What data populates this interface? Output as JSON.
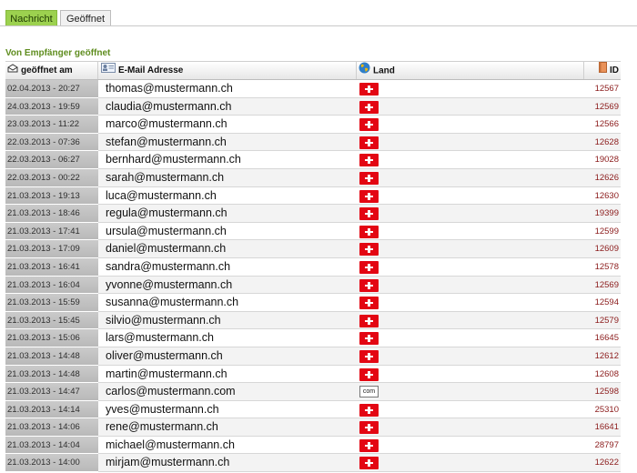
{
  "tabs": [
    {
      "label": "Nachricht",
      "active": true
    },
    {
      "label": "Geöffnet",
      "active": false
    }
  ],
  "section_title": "Von Empfänger geöffnet",
  "columns": {
    "opened_at": "geöffnet am",
    "email": "E-Mail Adresse",
    "country": "Land",
    "id": "ID"
  },
  "colors": {
    "accent_green": "#9cd14f",
    "title_green": "#5f8d1f",
    "id_red": "#8b1b1b",
    "flag_red": "#e30613"
  },
  "rows": [
    {
      "date": "02.04.2013 - 20:27",
      "email": "thomas@mustermann.ch",
      "country": "ch",
      "id": "12567"
    },
    {
      "date": "24.03.2013 - 19:59",
      "email": "claudia@mustermann.ch",
      "country": "ch",
      "id": "12569"
    },
    {
      "date": "23.03.2013 - 11:22",
      "email": "marco@mustermann.ch",
      "country": "ch",
      "id": "12566"
    },
    {
      "date": "22.03.2013 - 07:36",
      "email": "stefan@mustermann.ch",
      "country": "ch",
      "id": "12628"
    },
    {
      "date": "22.03.2013 - 06:27",
      "email": "bernhard@mustermann.ch",
      "country": "ch",
      "id": "19028"
    },
    {
      "date": "22.03.2013 - 00:22",
      "email": "sarah@mustermann.ch",
      "country": "ch",
      "id": "12626"
    },
    {
      "date": "21.03.2013 - 19:13",
      "email": "luca@mustermann.ch",
      "country": "ch",
      "id": "12630"
    },
    {
      "date": "21.03.2013 - 18:46",
      "email": "regula@mustermann.ch",
      "country": "ch",
      "id": "19399"
    },
    {
      "date": "21.03.2013 - 17:41",
      "email": "ursula@mustermann.ch",
      "country": "ch",
      "id": "12599"
    },
    {
      "date": "21.03.2013 - 17:09",
      "email": "daniel@mustermann.ch",
      "country": "ch",
      "id": "12609"
    },
    {
      "date": "21.03.2013 - 16:41",
      "email": "sandra@mustermann.ch",
      "country": "ch",
      "id": "12578"
    },
    {
      "date": "21.03.2013 - 16:04",
      "email": "yvonne@mustermann.ch",
      "country": "ch",
      "id": "12569"
    },
    {
      "date": "21.03.2013 - 15:59",
      "email": "susanna@mustermann.ch",
      "country": "ch",
      "id": "12594"
    },
    {
      "date": "21.03.2013 - 15:45",
      "email": "silvio@mustermann.ch",
      "country": "ch",
      "id": "12579"
    },
    {
      "date": "21.03.2013 - 15:06",
      "email": "lars@mustermann.ch",
      "country": "ch",
      "id": "16645"
    },
    {
      "date": "21.03.2013 - 14:48",
      "email": "oliver@mustermann.ch",
      "country": "ch",
      "id": "12612"
    },
    {
      "date": "21.03.2013 - 14:48",
      "email": "martin@mustermann.ch",
      "country": "ch",
      "id": "12608"
    },
    {
      "date": "21.03.2013 - 14:47",
      "email": "carlos@mustermann.com",
      "country": "com",
      "country_label": "com",
      "id": "12598"
    },
    {
      "date": "21.03.2013 - 14:14",
      "email": "yves@mustermann.ch",
      "country": "ch",
      "id": "25310"
    },
    {
      "date": "21.03.2013 - 14:06",
      "email": "rene@mustermann.ch",
      "country": "ch",
      "id": "16641"
    },
    {
      "date": "21.03.2013 - 14:04",
      "email": "michael@mustermann.ch",
      "country": "ch",
      "id": "28797"
    },
    {
      "date": "21.03.2013 - 14:00",
      "email": "mirjam@mustermann.ch",
      "country": "ch",
      "id": "12622"
    }
  ]
}
